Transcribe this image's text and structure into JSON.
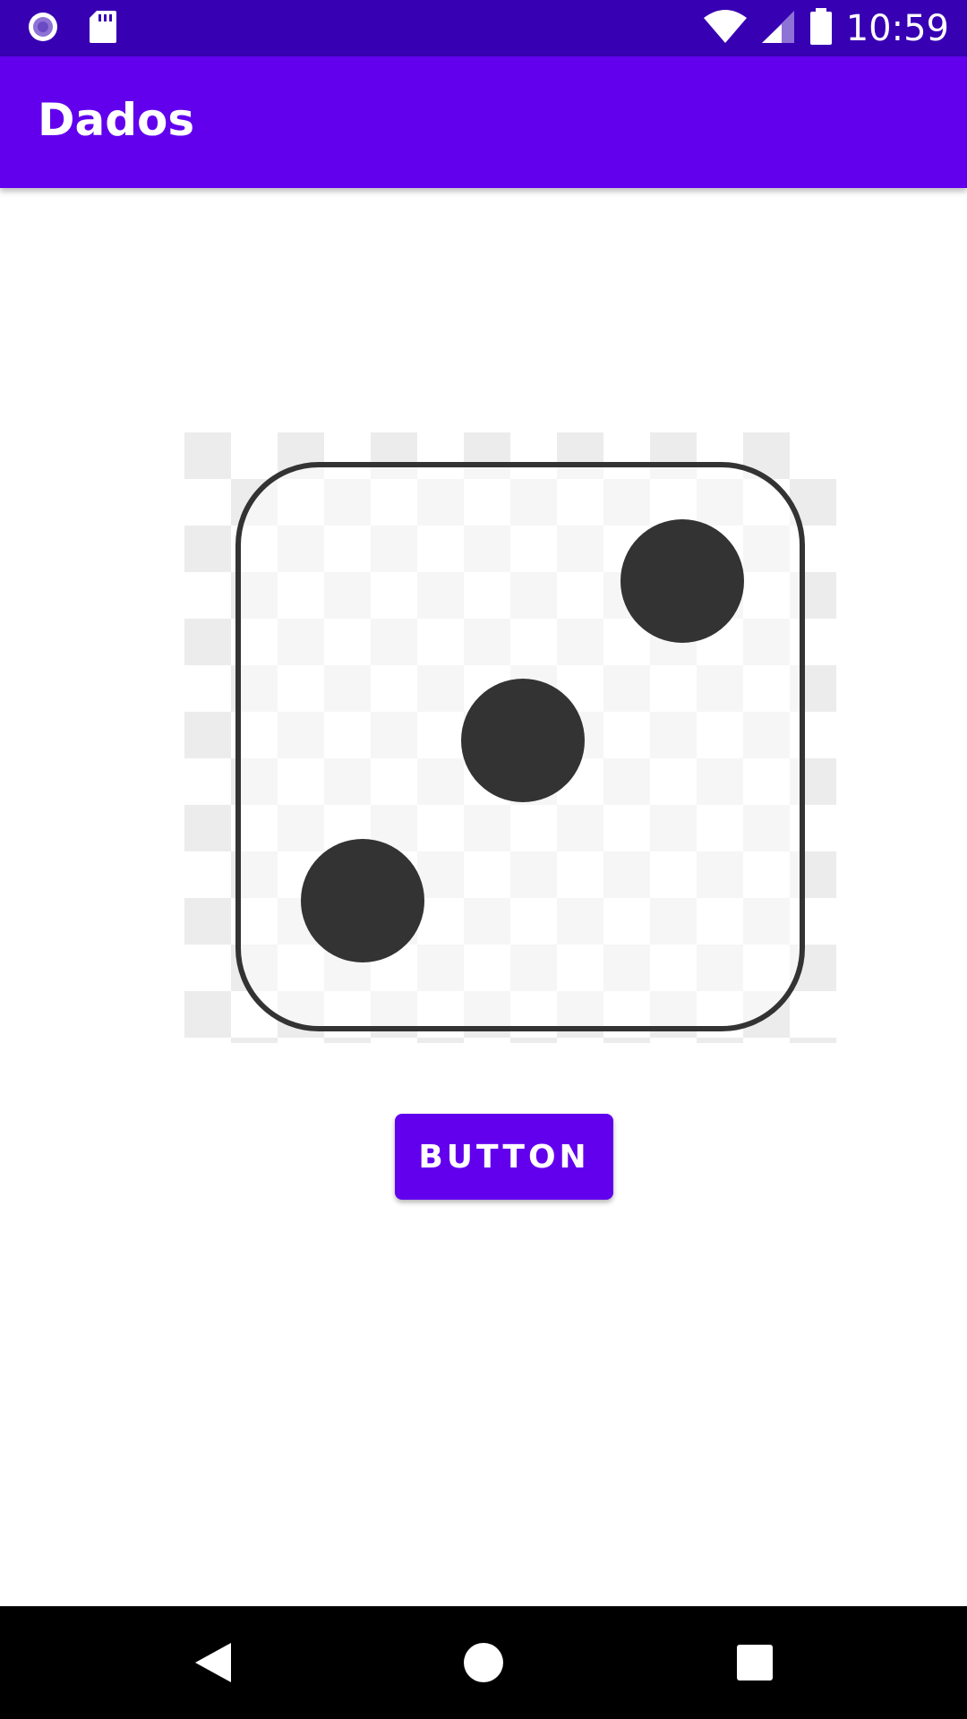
{
  "status_bar": {
    "time": "10:59",
    "icons": [
      "record-icon",
      "sd-card-icon",
      "wifi-icon",
      "signal-icon",
      "battery-icon"
    ]
  },
  "app_bar": {
    "title": "Dados"
  },
  "dice": {
    "face_value": 3
  },
  "roll_button": {
    "label": "BUTTON"
  },
  "nav_bar": {
    "icons": [
      "back-icon",
      "home-icon",
      "recents-icon"
    ]
  },
  "colors": {
    "status_bar": "#3700b3",
    "primary": "#6200ee",
    "nav_bar": "#000000",
    "pip": "#333333"
  }
}
